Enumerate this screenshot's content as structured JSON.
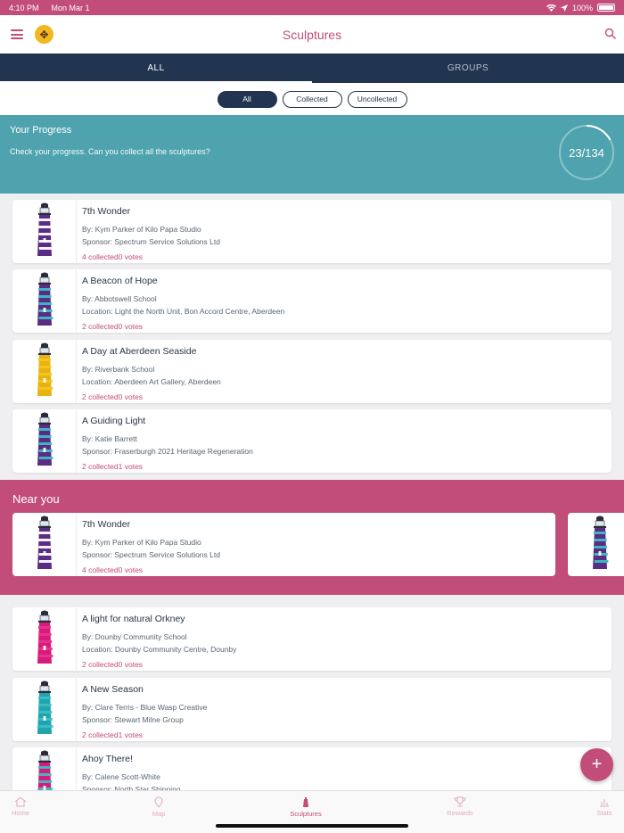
{
  "status_bar": {
    "time": "4:10 PM",
    "date": "Mon Mar 1",
    "battery": "100%"
  },
  "header": {
    "title": "Sculptures"
  },
  "tabs": [
    {
      "label": "ALL",
      "active": true
    },
    {
      "label": "GROUPS",
      "active": false
    }
  ],
  "filters": [
    {
      "label": "All",
      "active": true
    },
    {
      "label": "Collected",
      "active": false
    },
    {
      "label": "Uncollected",
      "active": false
    }
  ],
  "progress": {
    "title": "Your Progress",
    "subtitle": "Check your progress. Can you collect all the sculptures?",
    "label": "23/134",
    "collected": 23,
    "total": 134
  },
  "sculptures": [
    {
      "name": "7th Wonder",
      "line1": "By: Kym Parker of Kilo Papa Studio",
      "line2": "Sponsor: Spectrum Service Solutions Ltd",
      "stats": "4 collected0 votes",
      "colors": [
        "#ffffff",
        "#5b2c83"
      ]
    },
    {
      "name": "A Beacon of Hope",
      "line1": "By: Abbotswell School",
      "line2": "Location: Light the North Unit, Bon Accord Centre, Aberdeen",
      "stats": "2 collected0 votes",
      "colors": [
        "#3dbdc6",
        "#5b2c83"
      ]
    },
    {
      "name": "A Day at Aberdeen Seaside",
      "line1": "By: Riverbank School",
      "line2": "Location: Aberdeen Art Gallery, Aberdeen",
      "stats": "2 collected0 votes",
      "colors": [
        "#f5c424",
        "#e8b310"
      ]
    },
    {
      "name": "A Guiding Light",
      "line1": "By: Katie Barrett",
      "line2": "Sponsor: Fraserburgh 2021 Heritage Regeneration",
      "stats": "2 collected1 votes",
      "colors": [
        "#3dbdc6",
        "#5b2c83"
      ]
    }
  ],
  "near_you": {
    "title": "Near you",
    "items": [
      {
        "name": "7th Wonder",
        "line1": "By: Kym Parker of Kilo Papa Studio",
        "line2": "Sponsor: Spectrum Service Solutions Ltd",
        "stats": "4 collected0 votes",
        "colors": [
          "#ffffff",
          "#5b2c83"
        ]
      },
      {
        "colors": [
          "#3dbdc6",
          "#5b2c83"
        ]
      }
    ]
  },
  "more_sculptures": [
    {
      "name": "A light for natural Orkney",
      "line1": "By: Dounby Community School",
      "line2": "Location: Dounby Community Centre, Dounby",
      "stats": "2 collected0 votes",
      "colors": [
        "#e9338f",
        "#d81b7a"
      ]
    },
    {
      "name": "A New Season",
      "line1": "By: Clare Terris - Blue Wasp Creative",
      "line2": "Sponsor: Stewart Milne Group",
      "stats": "2 collected1 votes",
      "colors": [
        "#3dbdc6",
        "#1fa6ad"
      ]
    },
    {
      "name": "Ahoy There!",
      "line1": "By: Calene Scott-White",
      "line2": "Sponsor: North Star Shipping",
      "stats": "",
      "colors": [
        "#3dbdc6",
        "#d81b7a"
      ]
    }
  ],
  "bottom_nav": [
    {
      "label": "Home",
      "active": false
    },
    {
      "label": "Map",
      "active": false
    },
    {
      "label": "Sculptures",
      "active": true
    },
    {
      "label": "Rewards",
      "active": false
    },
    {
      "label": "Stats",
      "active": false
    }
  ]
}
